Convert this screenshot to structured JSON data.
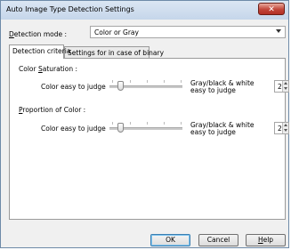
{
  "window": {
    "title": "Auto Image Type Detection Settings",
    "close_label": "✕"
  },
  "detection_mode": {
    "label_prefix": "",
    "label_accel": "D",
    "label_rest": "etection mode :",
    "value": "Color or Gray"
  },
  "tabs": [
    {
      "label": "Detection criteria",
      "active": true
    },
    {
      "label": "Settings for in case of binary",
      "active": false
    }
  ],
  "color_saturation": {
    "label_prefix": "Color ",
    "label_accel": "S",
    "label_rest": "aturation :",
    "left_label": "Color easy to judge",
    "right_label": "Gray/black & white easy to judge",
    "value": "2"
  },
  "proportion_of_color": {
    "label_prefix": "",
    "label_accel": "P",
    "label_rest": "roportion of Color :",
    "left_label": "Color easy to judge",
    "right_label": "Gray/black & white easy to judge",
    "value": "2"
  },
  "buttons": {
    "ok": "OK",
    "cancel": "Cancel",
    "help_accel": "H",
    "help_rest": "elp"
  }
}
